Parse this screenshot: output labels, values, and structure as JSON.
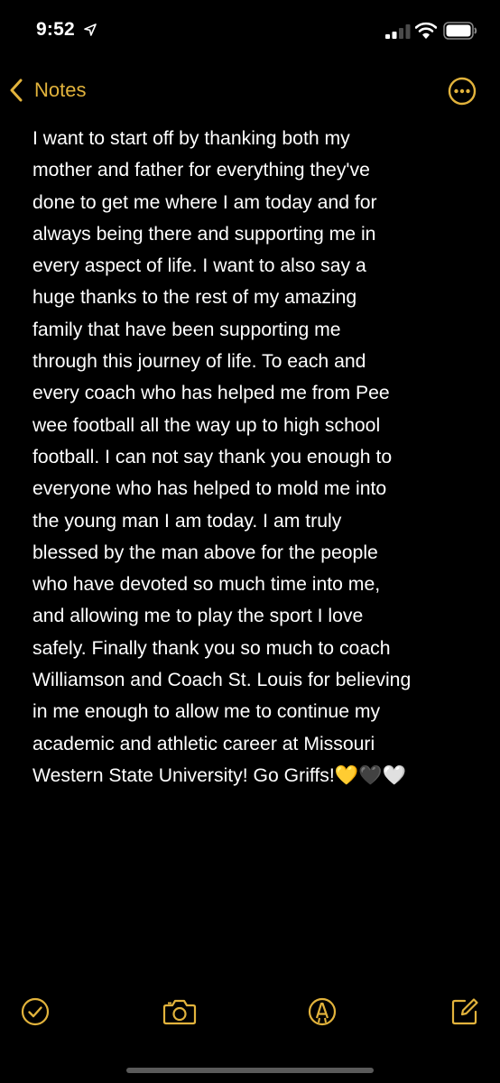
{
  "status_bar": {
    "time": "9:52",
    "icons": [
      "location-arrow-icon",
      "cellular-signal-icon",
      "wifi-icon",
      "battery-icon"
    ]
  },
  "nav": {
    "back_label": "Notes",
    "back_icon": "chevron-left-icon",
    "more_icon": "ellipsis-circle-icon"
  },
  "note": {
    "lines": [
      "I want to start off by thanking both my",
      "mother and father for everything they've",
      "done to get me where I am today and for",
      "always being there and supporting me in",
      "every aspect of life. I want to also say a",
      "huge thanks to the rest of my amazing",
      "family that have been supporting me",
      "through this journey of life. To each and",
      "every coach who has helped me from Pee",
      "wee football all the way up to high school",
      "football. I can not say thank you enough to",
      "everyone who has helped to mold me into",
      "the young man I am today. I am truly",
      "blessed by the man above for the people",
      "who have devoted so much time into me,",
      "and allowing me to play the sport I love",
      "safely. Finally thank you so much to coach",
      "Williamson and Coach St. Louis for believing",
      "in me enough to allow me to continue my",
      "academic and athletic career at Missouri",
      "Western State University! Go Griffs!💛🖤🤍"
    ]
  },
  "toolbar": {
    "icons": [
      "checklist-icon",
      "camera-icon",
      "markup-icon",
      "compose-icon"
    ]
  },
  "colors": {
    "accent": "#e2b33c",
    "background": "#000000",
    "text": "#ffffff"
  }
}
